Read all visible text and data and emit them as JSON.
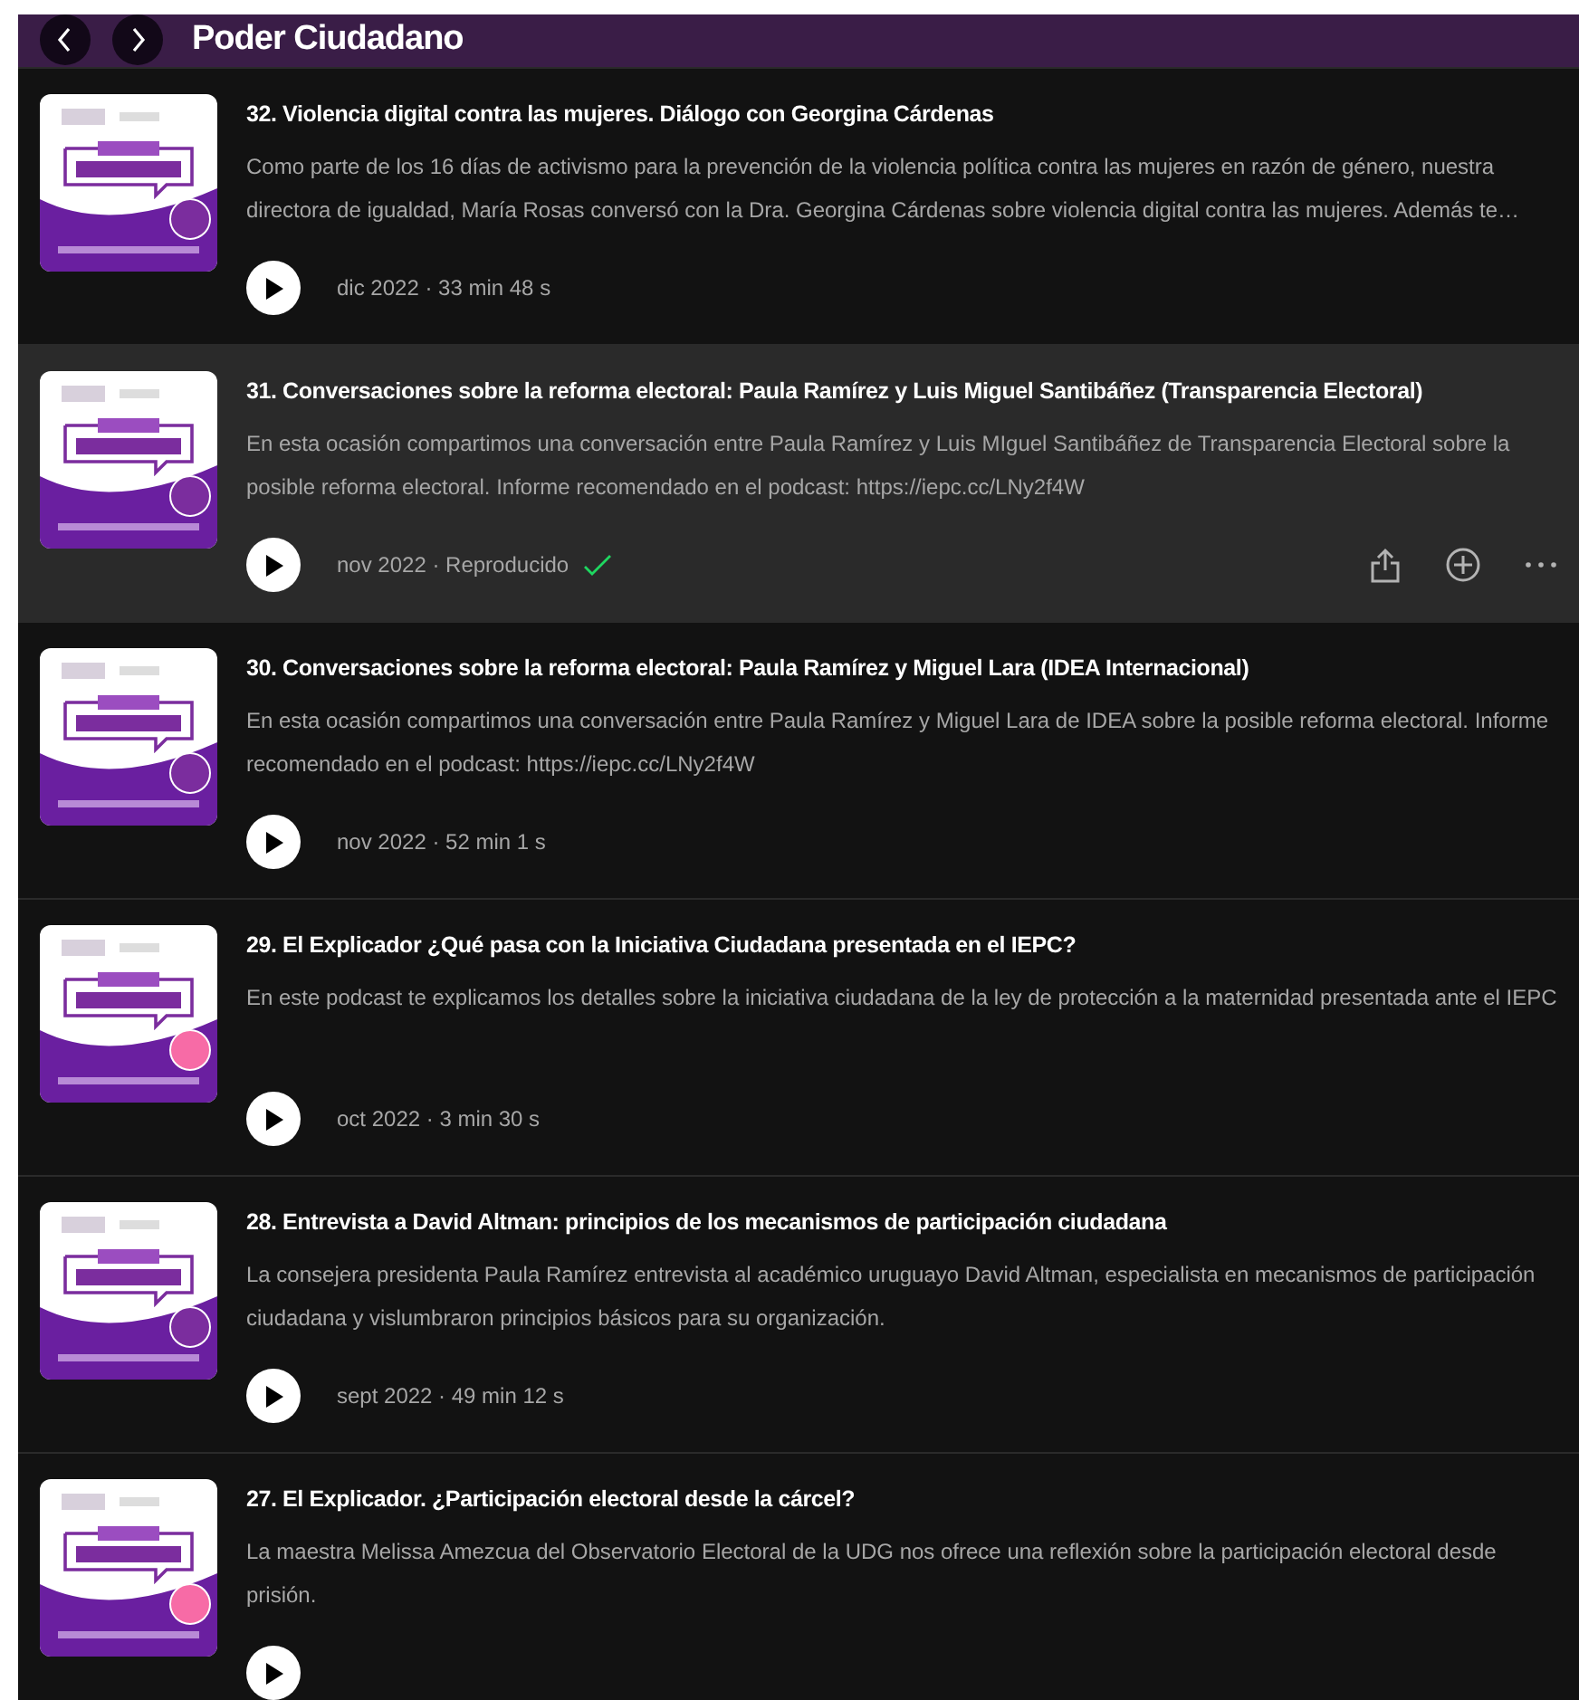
{
  "header": {
    "title": "Poder Ciudadano"
  },
  "episodes": [
    {
      "title": "32. Violencia digital contra las mujeres. Diálogo con Georgina Cárdenas",
      "description": "Como parte de los 16 días de activismo para la prevención de la violencia política contra las mujeres en razón de género, nuestra directora de igualdad, María Rosas conversó con la Dra. Georgina Cárdenas sobre violencia digital contra las mujeres. Además te…",
      "meta": "dic 2022 · 33 min 48 s",
      "played": false,
      "highlighted": false,
      "color": "#7b2d9e"
    },
    {
      "title": "31. Conversaciones sobre la reforma electoral: Paula Ramírez y Luis Miguel Santibáñez (Transparencia Electoral)",
      "description": "En esta ocasión compartimos una conversación entre Paula Ramírez y Luis MIguel Santibáñez de Transparencia Electoral sobre la posible reforma electoral. Informe recomendado en el podcast: https://iepc.cc/LNy2f4W",
      "meta": "nov 2022 · Reproducido",
      "played": true,
      "highlighted": true,
      "color": "#7b2d9e"
    },
    {
      "title": "30. Conversaciones sobre la reforma electoral: Paula Ramírez y Miguel Lara (IDEA Internacional)",
      "description": "En esta ocasión compartimos una conversación entre Paula Ramírez y Miguel Lara de IDEA sobre la posible reforma electoral. Informe recomendado en el podcast: https://iepc.cc/LNy2f4W",
      "meta": "nov 2022 · 52 min 1 s",
      "played": false,
      "highlighted": false,
      "color": "#7b2d9e"
    },
    {
      "title": "29. El Explicador ¿Qué pasa con la Iniciativa Ciudadana presentada en el IEPC?",
      "description": "En este podcast te explicamos los detalles sobre la iniciativa ciudadana de la ley de protección a la maternidad presentada ante el IEPC",
      "meta": "oct 2022 · 3 min 30 s",
      "played": false,
      "highlighted": false,
      "color": "#f76ba6"
    },
    {
      "title": "28. Entrevista a David Altman: principios de los mecanismos de participación ciudadana",
      "description": "La consejera presidenta Paula Ramírez entrevista al académico uruguayo David Altman, especialista en mecanismos de participación ciudadana y vislumbraron principios básicos para su organización.",
      "meta": "sept 2022 · 49 min 12 s",
      "played": false,
      "highlighted": false,
      "color": "#7b2d9e"
    },
    {
      "title": "27. El Explicador. ¿Participación electoral desde la cárcel?",
      "description": "La maestra Melissa Amezcua del Observatorio Electoral de la UDG nos ofrece una reflexión sobre la participación electoral desde prisión.",
      "played": false,
      "highlighted": false,
      "color": "#f76ba6"
    }
  ]
}
